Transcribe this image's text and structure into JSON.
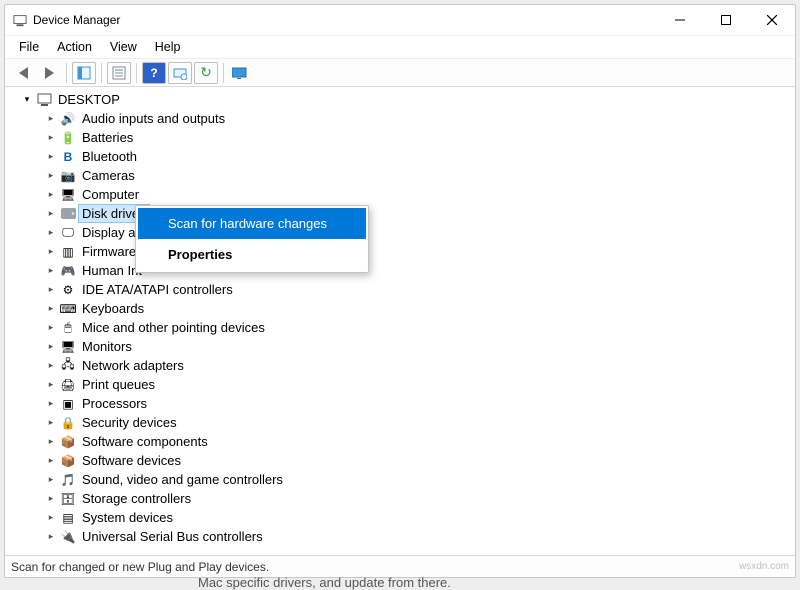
{
  "window": {
    "title": "Device Manager"
  },
  "menu": {
    "file": "File",
    "action": "Action",
    "view": "View",
    "help": "Help"
  },
  "tree": {
    "root": "DESKTOP",
    "items": {
      "audio": "Audio inputs and outputs",
      "batteries": "Batteries",
      "bluetooth": "Bluetooth",
      "cameras": "Cameras",
      "computer": "Computer",
      "disk": "Disk drives",
      "display": "Display ad",
      "firmware": "Firmware",
      "hid": "Human Int",
      "ide": "IDE ATA/ATAPI controllers",
      "keyboards": "Keyboards",
      "mice": "Mice and other pointing devices",
      "monitors": "Monitors",
      "network": "Network adapters",
      "print": "Print queues",
      "processors": "Processors",
      "security": "Security devices",
      "swcomp": "Software components",
      "swdev": "Software devices",
      "sound": "Sound, video and game controllers",
      "storage": "Storage controllers",
      "system": "System devices",
      "usb": "Universal Serial Bus controllers"
    }
  },
  "context_menu": {
    "scan": "Scan for hardware changes",
    "props": "Properties"
  },
  "statusbar": {
    "text": "Scan for changed or new Plug and Play devices.",
    "watermark": "wsxdn.com"
  },
  "background_fragment": "Mac specific drivers, and update from there.",
  "icons": {
    "computer": "💻",
    "speaker": "🔊",
    "battery": "🔋",
    "bluetooth": "B",
    "camera": "📷",
    "monitor": "🖥",
    "disk": "💾",
    "display": "🖵",
    "firmware": "▥",
    "hid": "🎮",
    "ide": "⚙",
    "keyboard": "⌨",
    "mouse": "🖱",
    "network": "🖧",
    "printer": "🖨",
    "cpu": "▣",
    "lock": "🔒",
    "sw": "📦",
    "sound": "🎵",
    "storage": "🗄",
    "chip": "▤",
    "usb": "🔌",
    "help": "?",
    "refresh": "↻",
    "props": "☰"
  }
}
